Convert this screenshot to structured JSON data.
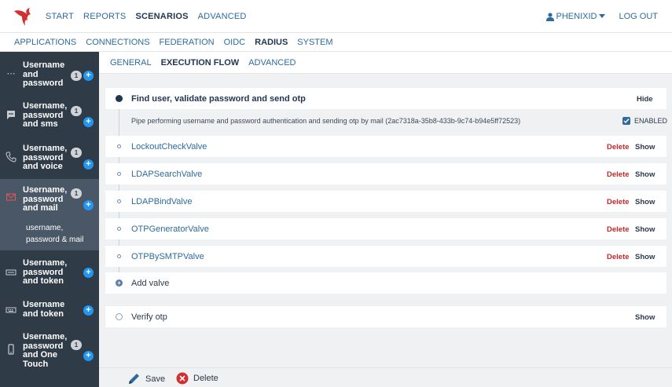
{
  "topnav": {
    "items": [
      "START",
      "REPORTS",
      "SCENARIOS",
      "ADVANCED"
    ],
    "active": "SCENARIOS",
    "user": "PHENIXID",
    "logout": "LOG OUT"
  },
  "subnav": {
    "items": [
      "APPLICATIONS",
      "CONNECTIONS",
      "FEDERATION",
      "OIDC",
      "RADIUS",
      "SYSTEM"
    ],
    "active": "RADIUS"
  },
  "sidebar": {
    "items": [
      {
        "label": "Username and password",
        "lines": [
          "Username",
          "and",
          "password"
        ],
        "badge": "1",
        "icon": "dots-icon"
      },
      {
        "label": "Username, password and sms",
        "lines": [
          "Username,",
          "password",
          "and sms"
        ],
        "badge": "1",
        "icon": "sms-icon"
      },
      {
        "label": "Username, password and voice",
        "lines": [
          "Username,",
          "password",
          "and voice"
        ],
        "badge": "1",
        "icon": "phone-icon"
      },
      {
        "label": "Username, password and mail",
        "lines": [
          "Username,",
          "password",
          "and mail"
        ],
        "badge": "1",
        "icon": "mail-icon",
        "active": true,
        "subitem": [
          "username,",
          "password & mail"
        ]
      },
      {
        "label": "Username, password and token",
        "lines": [
          "Username,",
          "password",
          "and token"
        ],
        "badge": "",
        "icon": "token-icon"
      },
      {
        "label": "Username and token",
        "lines": [
          "Username",
          "and token"
        ],
        "badge": "",
        "icon": "keyboard-icon"
      },
      {
        "label": "Username, password and One Touch",
        "lines": [
          "Username,",
          "password",
          "and One",
          "Touch"
        ],
        "badge": "1",
        "icon": "mobile-icon"
      }
    ]
  },
  "tabs": {
    "items": [
      "GENERAL",
      "EXECUTION FLOW",
      "ADVANCED"
    ],
    "active": "EXECUTION FLOW"
  },
  "flow": {
    "pipe_title": "Find user, validate password and send otp",
    "hide_label": "Hide",
    "pipe_description": "Pipe performing username and password authentication and sending otp by mail (2ac7318a-35b8-433b-9c74-b94e5ff72523)",
    "enabled_label": "ENABLED",
    "valves": [
      "LockoutCheckValve",
      "LDAPSearchValve",
      "LDAPBindValve",
      "OTPGeneratorValve",
      "OTPBySMTPValve"
    ],
    "delete_label": "Delete",
    "show_label": "Show",
    "add_valve": "Add valve",
    "verify_title": "Verify otp"
  },
  "footer": {
    "save": "Save",
    "delete": "Delete"
  },
  "colors": {
    "sidebar_bg": "#2f3b47",
    "sidebar_active": "#4a5766",
    "accent_blue": "#2196f3",
    "link_blue": "#2d6a9f",
    "delete_red": "#c62828",
    "logo_red": "#d32f2f"
  }
}
